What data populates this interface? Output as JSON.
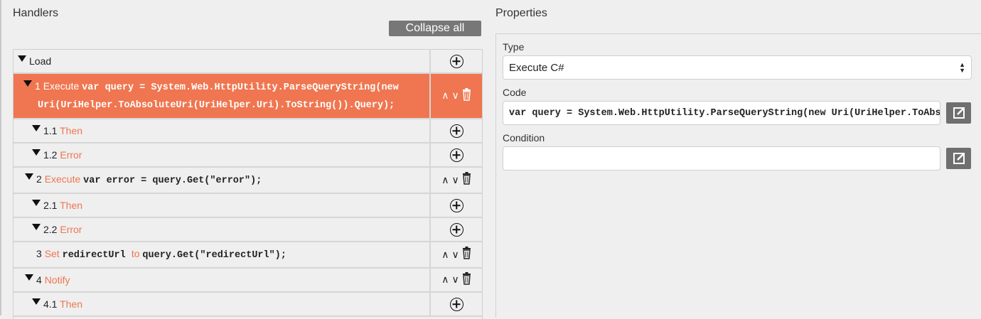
{
  "handlers": {
    "title": "Handlers",
    "collapse_label": "Collapse all"
  },
  "tree": [
    {
      "level": 0,
      "toggle": true,
      "num": "",
      "keyword": "",
      "label": "Load",
      "code": "",
      "actions": "add"
    },
    {
      "level": 1,
      "toggle": true,
      "num": "1",
      "keyword": "Execute",
      "code": "var query = System.Web.HttpUtility.ParseQueryString(new Uri(UriHelper.ToAbsoluteUri(UriHelper.Uri).ToString()).Query);",
      "actions": "move",
      "selected": true
    },
    {
      "level": 2,
      "toggle": true,
      "num": "1.1",
      "keyword": "Then",
      "actions": "add"
    },
    {
      "level": 2,
      "toggle": true,
      "num": "1.2",
      "keyword": "Error",
      "actions": "add"
    },
    {
      "level": 1,
      "toggle": true,
      "num": "2",
      "keyword": "Execute",
      "code": "var error = query.Get(\"error\");",
      "actions": "move"
    },
    {
      "level": 2,
      "toggle": true,
      "num": "2.1",
      "keyword": "Then",
      "actions": "add"
    },
    {
      "level": 2,
      "toggle": true,
      "num": "2.2",
      "keyword": "Error",
      "actions": "add"
    },
    {
      "level": 1,
      "toggle": false,
      "num": "3",
      "keyword": "Set",
      "code": "redirectUrl",
      "keyword2": "to",
      "code2": "query.Get(\"redirectUrl\");",
      "actions": "move"
    },
    {
      "level": 1,
      "toggle": true,
      "num": "4",
      "keyword": "Notify",
      "actions": "move"
    },
    {
      "level": 2,
      "toggle": true,
      "num": "4.1",
      "keyword": "Then",
      "actions": "add"
    }
  ],
  "properties": {
    "title": "Properties",
    "type_label": "Type",
    "type_value": "Execute C#",
    "code_label": "Code",
    "code_value": "var query = System.Web.HttpUtility.ParseQueryString(new Uri(UriHelper.ToAbsoluteUri(UriHelper.Uri).ToString()).Query);",
    "condition_label": "Condition",
    "condition_value": ""
  },
  "colors": {
    "accent": "#ef7650",
    "button": "#777777"
  }
}
